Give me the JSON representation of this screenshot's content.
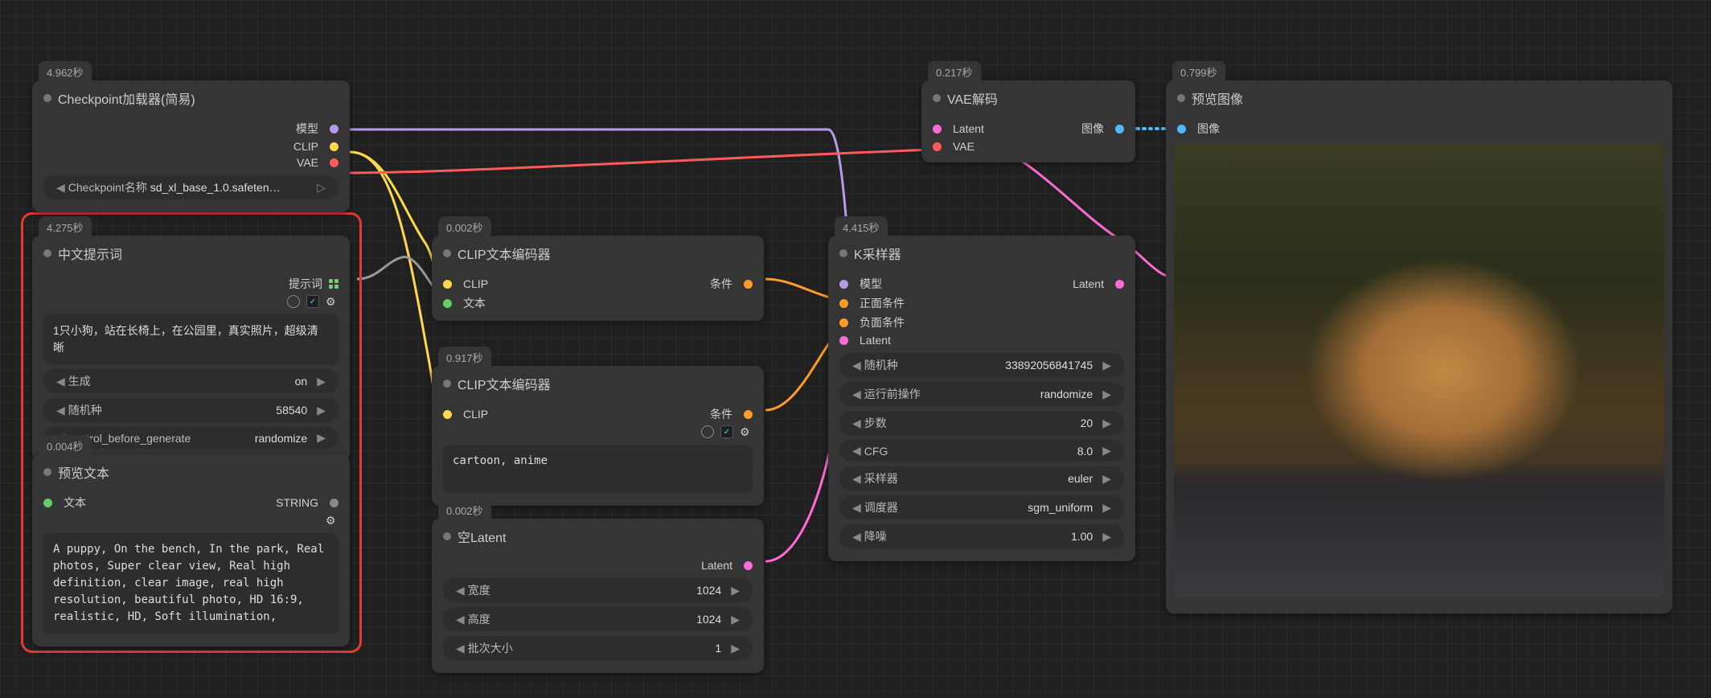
{
  "checkpoint": {
    "time": "4.962秒",
    "title": "Checkpoint加载器(简易)",
    "outputs": [
      "模型",
      "CLIP",
      "VAE"
    ],
    "widget": {
      "label": "Checkpoint名称",
      "value": "sd_xl_base_1.0.safeten…"
    }
  },
  "cn_prompt": {
    "time": "4.275秒",
    "title": "中文提示词",
    "output": "提示词",
    "text": "1只小狗，站在长椅上，在公园里，真实照片，超级清晰",
    "widgets": [
      {
        "label": "生成",
        "value": "on"
      },
      {
        "label": "随机种",
        "value": "58540"
      },
      {
        "label": "control_before_generate",
        "value": "randomize"
      }
    ]
  },
  "preview_text": {
    "time": "0.004秒",
    "title": "预览文本",
    "input": "文本",
    "output": "STRING",
    "text": "A puppy, On the bench, In the park, Real photos, Super clear view, Real high definition, clear image, real high resolution, beautiful photo, HD 16:9, realistic, HD, Soft illumination,"
  },
  "clip1": {
    "time": "0.002秒",
    "title": "CLIP文本编码器",
    "inputs": [
      "CLIP",
      "文本"
    ],
    "output": "条件"
  },
  "clip2": {
    "time": "0.917秒",
    "title": "CLIP文本编码器",
    "input": "CLIP",
    "output": "条件",
    "text": "cartoon, anime"
  },
  "empty_latent": {
    "time": "0.002秒",
    "title": "空Latent",
    "output": "Latent",
    "widgets": [
      {
        "label": "宽度",
        "value": "1024"
      },
      {
        "label": "高度",
        "value": "1024"
      },
      {
        "label": "批次大小",
        "value": "1"
      }
    ]
  },
  "ksampler": {
    "time": "4.415秒",
    "title": "K采样器",
    "inputs": [
      "模型",
      "正面条件",
      "负面条件",
      "Latent"
    ],
    "output": "Latent",
    "widgets": [
      {
        "label": "随机种",
        "value": "33892056841745"
      },
      {
        "label": "运行前操作",
        "value": "randomize"
      },
      {
        "label": "步数",
        "value": "20"
      },
      {
        "label": "CFG",
        "value": "8.0"
      },
      {
        "label": "采样器",
        "value": "euler"
      },
      {
        "label": "调度器",
        "value": "sgm_uniform"
      },
      {
        "label": "降噪",
        "value": "1.00"
      }
    ]
  },
  "vae": {
    "time": "0.217秒",
    "title": "VAE解码",
    "inputs": [
      "Latent",
      "VAE"
    ],
    "output": "图像"
  },
  "preview_img": {
    "time": "0.799秒",
    "title": "预览图像",
    "input": "图像"
  }
}
